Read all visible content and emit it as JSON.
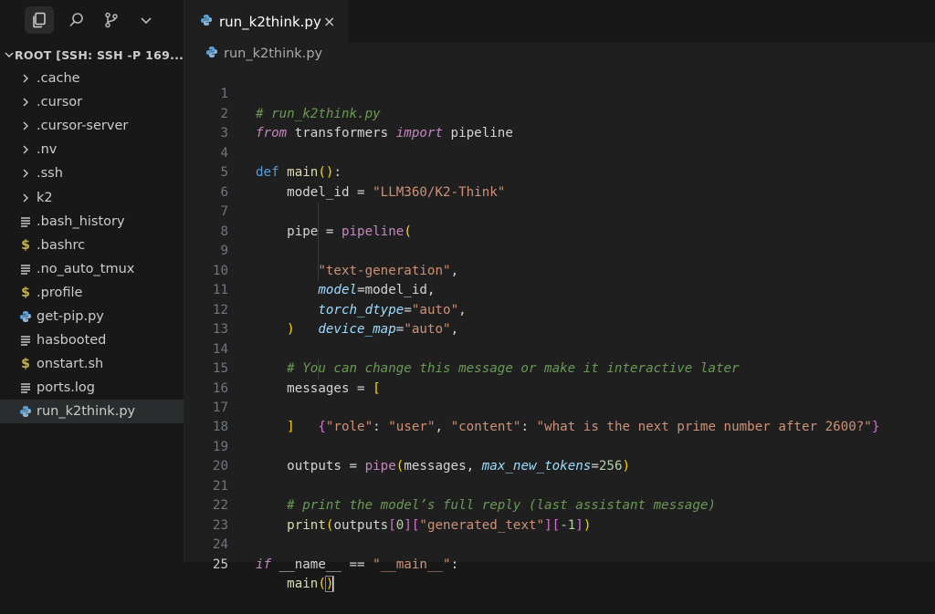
{
  "sidebar": {
    "root_label": "ROOT [SSH: SSH -P 169...",
    "items": [
      {
        "label": ".cache",
        "kind": "folder"
      },
      {
        "label": ".cursor",
        "kind": "folder"
      },
      {
        "label": ".cursor-server",
        "kind": "folder"
      },
      {
        "label": ".nv",
        "kind": "folder"
      },
      {
        "label": ".ssh",
        "kind": "folder"
      },
      {
        "label": "k2",
        "kind": "folder"
      },
      {
        "label": ".bash_history",
        "kind": "text"
      },
      {
        "label": ".bashrc",
        "kind": "shell"
      },
      {
        "label": ".no_auto_tmux",
        "kind": "text"
      },
      {
        "label": ".profile",
        "kind": "shell"
      },
      {
        "label": "get-pip.py",
        "kind": "python"
      },
      {
        "label": "hasbooted",
        "kind": "text"
      },
      {
        "label": "onstart.sh",
        "kind": "shell"
      },
      {
        "label": "ports.log",
        "kind": "text"
      },
      {
        "label": "run_k2think.py",
        "kind": "python",
        "selected": true
      }
    ]
  },
  "tab": {
    "label": "run_k2think.py",
    "close": "×"
  },
  "breadcrumb": "run_k2think.py",
  "editor": {
    "line_numbers": [
      "1",
      "2",
      "3",
      "4",
      "5",
      "6",
      "7",
      "8",
      "9",
      "10",
      "11",
      "12",
      "13",
      "14",
      "15",
      "16",
      "17",
      "18",
      "19",
      "20",
      "21",
      "22",
      "23",
      "24",
      "25"
    ],
    "current_line": 25,
    "t": {
      "l1": "# run_k2think.py",
      "from": "from",
      "transformers": " transformers ",
      "import": "import",
      "pipeline": " pipeline",
      "def": "def",
      "main": " main",
      "lp": "(",
      "rp": ")",
      "colon": ":",
      "model_id_eq": "model_id = ",
      "model_id_val": "\"LLM360/K2-Think\"",
      "pipe_eq": "pipe = ",
      "pipeline_fn": "pipeline",
      "text_gen": "\"text-generation\"",
      "comma": ",",
      "model": "model",
      "eq_model_id": "=model_id,",
      "torch_dtype": "torch_dtype",
      "eq": "=",
      "auto": "\"auto\"",
      "device_map": "device_map",
      "c14": "# You can change this message or make it interactive later",
      "messages_eq": "messages = ",
      "lbr": "[",
      "rbr": "]",
      "lbrace": "{",
      "rbrace": "}",
      "role": "\"role\"",
      "colsp": ": ",
      "user": "\"user\"",
      "commasp": ", ",
      "content": "\"content\"",
      "q": "\"what is the next prime number after 2600?\"",
      "outputs_eq": "outputs = ",
      "pipe_fn": "pipe",
      "messages_arg": "messages, ",
      "max_new_tokens": "max_new_tokens",
      "n256": "256",
      "c21": "# print the model’s full reply (last assistant message)",
      "print": "print",
      "outputs": "outputs",
      "zero": "0",
      "gen_text": "\"generated_text\"",
      "neg1": "-1",
      "if": "if",
      "name_cmp": " __name__ == ",
      "main_str": "\"__main__\"",
      "main_call": "main"
    }
  },
  "colors": {
    "background": "#1f1f1f",
    "sidebar": "#181818",
    "keyword": "#569cd6",
    "string": "#ce9178",
    "comment": "#6a9955"
  },
  "icons": [
    "explorer-icon",
    "search-icon",
    "source-control-icon",
    "chevron-down-icon",
    "python-file-icon",
    "text-file-icon",
    "shell-file-icon",
    "chevron-right-icon"
  ]
}
